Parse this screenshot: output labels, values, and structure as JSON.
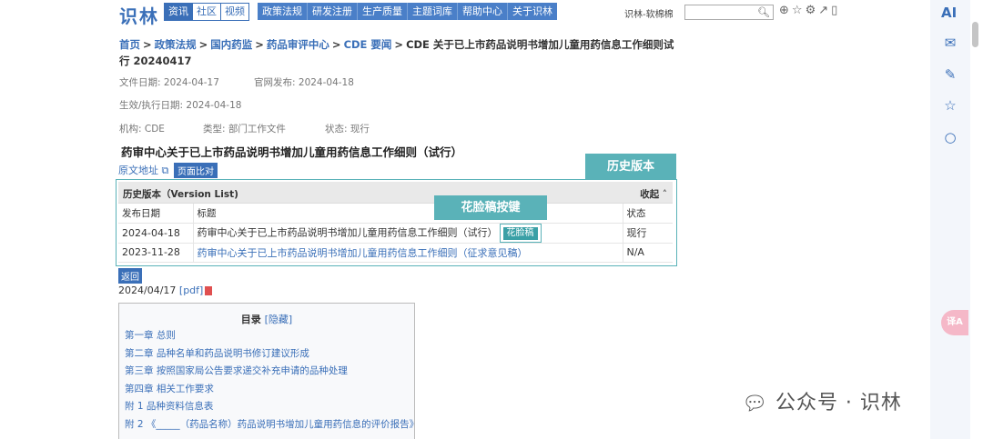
{
  "header": {
    "logo": "识林",
    "tabs": [
      "资讯",
      "社区",
      "视频"
    ],
    "nav": [
      "政策法规",
      "研发注册",
      "生产质量",
      "主题词库",
      "帮助中心",
      "关于识林"
    ],
    "user": "识林-软棉棉",
    "search_placeholder": ""
  },
  "breadcrumb": {
    "items": [
      "首页",
      "政策法规",
      "国内药监",
      "药品审评中心",
      "CDE 要闻"
    ],
    "current": "CDE 关于已上市药品说明书增加儿童用药信息工作细则试行 20240417"
  },
  "meta": {
    "file_date_label": "文件日期:",
    "file_date": "2024-04-17",
    "publish_label": "官网发布:",
    "publish_date": "2024-04-18",
    "effective_label": "生效/执行日期:",
    "effective_date": "2024-04-18",
    "org_label": "机构:",
    "org": "CDE",
    "type_label": "类型:",
    "type": "部门工作文件",
    "status_label": "状态:",
    "status": "现行"
  },
  "doc_title": "药审中心关于已上市药品说明书增加儿童用药信息工作细则（试行）",
  "orig_link": "原文地址",
  "compare_btn": "页面比对",
  "callouts": {
    "history": "历史版本",
    "face": "花脸稿按键"
  },
  "history": {
    "title": "历史版本（Version List)",
    "collapse": "收起",
    "headers": {
      "date": "发布日期",
      "title": "标题",
      "status": "状态"
    },
    "rows": [
      {
        "date": "2024-04-18",
        "title": "药审中心关于已上市药品说明书增加儿童用药信息工作细则（试行）",
        "face": "花脸稿",
        "status": "现行"
      },
      {
        "date": "2023-11-28",
        "title": "药审中心关于已上市药品说明书增加儿童用药信息工作细则（征求意见稿）",
        "status": "N/A"
      }
    ]
  },
  "back_btn": "返回",
  "date_line": {
    "date": "2024/04/17",
    "pdf": "[pdf]"
  },
  "toc": {
    "title": "目录",
    "hide": "[隐藏]",
    "items": [
      "第一章 总则",
      "第二章 品种名单和药品说明书修订建议形成",
      "第三章 按照国家局公告要求递交补充申请的品种处理",
      "第四章 相关工作要求",
      "附 1 品种资料信息表",
      "附 2 《_____（药品名称）药品说明书增加儿童用药信息的评价报告》"
    ]
  },
  "sidebar": {
    "ai": "AI",
    "translate": "译A"
  },
  "watermark": "公众号 · 识林",
  "colors": {
    "brand": "#3a6fb8",
    "callout": "#5ab2b8"
  }
}
